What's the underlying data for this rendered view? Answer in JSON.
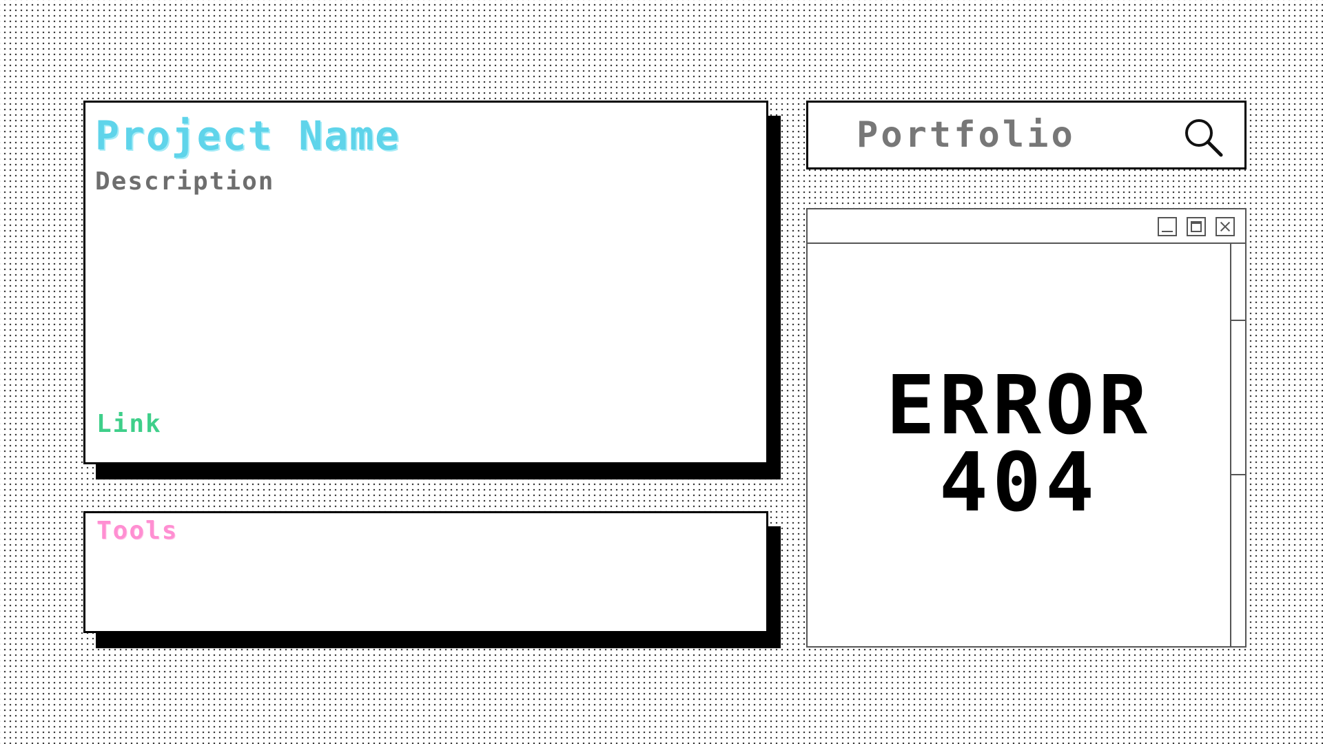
{
  "project_card": {
    "title": "Project Name",
    "description": "Description",
    "link": "Link"
  },
  "tools_card": {
    "label": "Tools"
  },
  "search": {
    "value": "Portfolio",
    "icon": "magnifier"
  },
  "error_window": {
    "line1": "ERROR",
    "line2": "404",
    "titlebar_buttons": [
      "minimize",
      "maximize",
      "close"
    ]
  },
  "colors": {
    "title": "#5fd4ea",
    "description": "#6e6e6e",
    "link": "#3fcf8a",
    "tools": "#ff8fd2",
    "search_text": "#777777",
    "background_dots": "#3a3a3a"
  }
}
